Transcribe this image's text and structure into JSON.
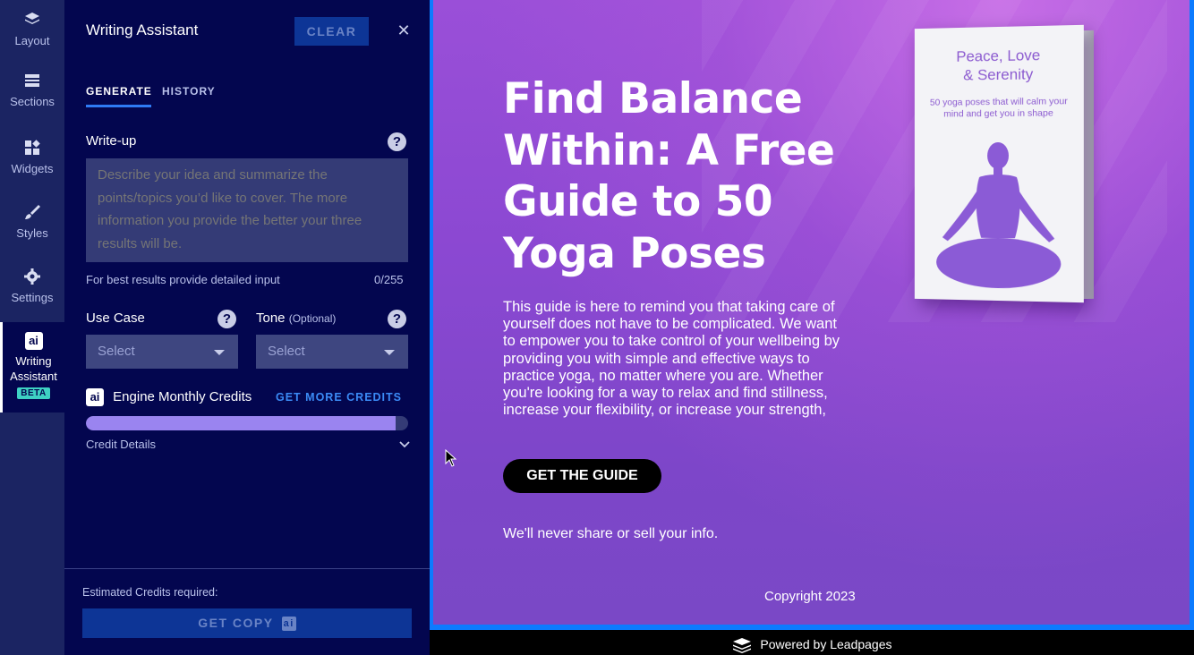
{
  "rail": {
    "items": [
      {
        "label": "Layout",
        "icon": "layers-icon"
      },
      {
        "label": "Sections",
        "icon": "sections-icon"
      },
      {
        "label": "Widgets",
        "icon": "widgets-icon"
      },
      {
        "label": "Styles",
        "icon": "brush-icon"
      },
      {
        "label": "Settings",
        "icon": "gear-icon"
      },
      {
        "label1": "Writing",
        "label2": "Assistant",
        "badge": "BETA",
        "icon": "ai-icon",
        "icon_text": "ai"
      }
    ]
  },
  "panel": {
    "title": "Writing Assistant",
    "clear_label": "CLEAR",
    "close_glyph": "✕",
    "tabs": [
      {
        "label": "GENERATE",
        "active": true
      },
      {
        "label": "HISTORY",
        "active": false
      }
    ],
    "writeup": {
      "label": "Write-up",
      "placeholder": "Describe your idea and summarize the points/topics you’d like to cover. The more information you provide the better your three results will be.",
      "hint": "For best results provide detailed input",
      "counter": "0/255"
    },
    "use_case": {
      "label": "Use Case",
      "value": "Select"
    },
    "tone": {
      "label": "Tone",
      "optional": "(Optional)",
      "value": "Select"
    },
    "help_glyph": "?",
    "credits": {
      "ai_badge": "ai",
      "label": "Engine Monthly Credits",
      "get_more": "GET MORE CREDITS",
      "fill_fraction": 0.96,
      "details_label": "Credit Details"
    },
    "estimated_label": "Estimated Credits required:",
    "get_copy_label": "GET COPY",
    "get_copy_badge": "ai"
  },
  "page": {
    "headline": "Find Balance Within: A Free Guide to 50 Yoga Poses",
    "body": "This guide is here to remind you that taking care of yourself does not have to be complicated. We want to empower you to take control of your wellbeing by providing you with simple and effective ways to practice yoga, no matter where you are. Whether you're looking for a way to relax and find stillness, increase your flexibility, or increase your strength,",
    "cta_label": "GET THE GUIDE",
    "privacy": "We'll never share or sell your info.",
    "copyright": "Copyright 2023",
    "book": {
      "title_line1": "Peace, Love",
      "title_line2": "& Serenity",
      "subtitle": "50 yoga poses that will calm your mind and get you in shape"
    }
  },
  "footer": {
    "label": "Powered by Leadpages",
    "icon": "leadpages-logo-icon"
  },
  "colors": {
    "rail_bg": "#1b2462",
    "panel_bg": "#03064f",
    "accent_blue": "#2f7bf5",
    "page_purple": "#8b48d2",
    "progress": "#9a84f0"
  }
}
